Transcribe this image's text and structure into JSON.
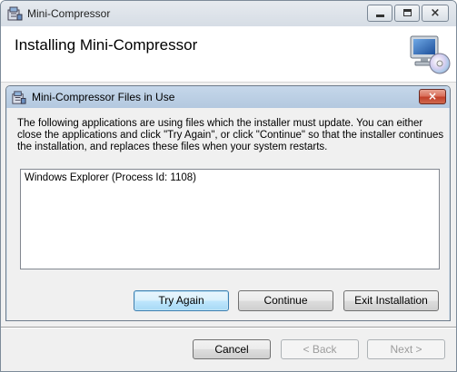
{
  "window": {
    "title": "Mini-Compressor",
    "controls": {
      "minimize": "minimize",
      "maximize": "maximize",
      "close": "×"
    }
  },
  "header": {
    "title": "Installing Mini-Compressor",
    "icon": "computer-cd-icon"
  },
  "dialog": {
    "title": "Mini-Compressor Files in Use",
    "close": "×",
    "message": "The following applications are using files which the installer must update. You can either close the applications and click \"Try Again\", or click \"Continue\" so that the installer continues the installation, and replaces these files when your system restarts.",
    "processes": [
      "Windows Explorer (Process Id: 1108)"
    ],
    "buttons": {
      "try_again": "Try Again",
      "continue": "Continue",
      "exit": "Exit Installation"
    }
  },
  "footer": {
    "cancel": "Cancel",
    "back": "< Back",
    "next": "Next >"
  },
  "colors": {
    "dialog_title_bar": "#bcd0e6",
    "close_button": "#c7432c",
    "default_button_border": "#3c7fb1"
  }
}
